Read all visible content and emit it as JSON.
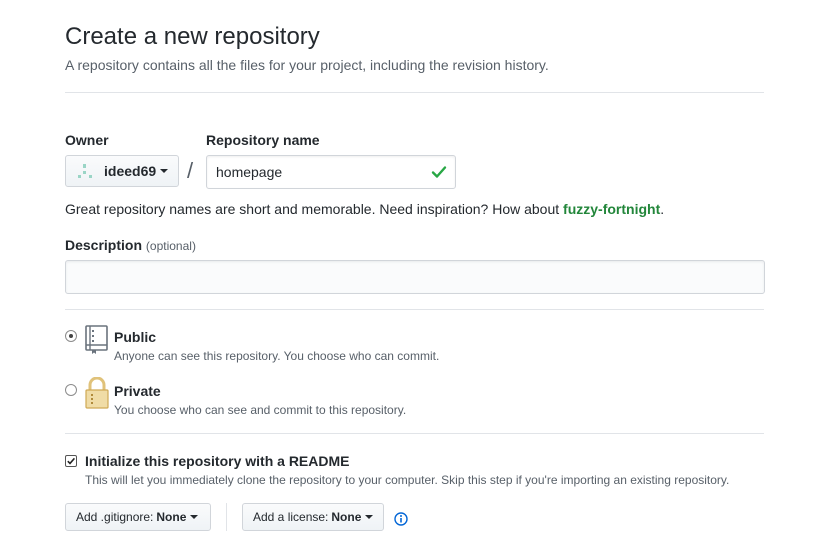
{
  "header": {
    "title": "Create a new repository",
    "subtitle": "A repository contains all the files for your project, including the revision history."
  },
  "owner": {
    "label": "Owner",
    "value": "ideed69"
  },
  "separator": "/",
  "repo_name": {
    "label": "Repository name",
    "value": "homepage"
  },
  "hint": {
    "text": "Great repository names are short and memorable. Need inspiration? How about ",
    "suggestion": "fuzzy-fortnight",
    "end": "."
  },
  "description": {
    "label": "Description",
    "optional": "(optional)",
    "value": ""
  },
  "visibility": {
    "public": {
      "title": "Public",
      "note": "Anyone can see this repository. You choose who can commit.",
      "selected": true
    },
    "private": {
      "title": "Private",
      "note": "You choose who can see and commit to this repository.",
      "selected": false
    }
  },
  "readme": {
    "label": "Initialize this repository with a README",
    "note": "This will let you immediately clone the repository to your computer. Skip this step if you're importing an existing repository.",
    "checked": true
  },
  "gitignore": {
    "prefix": "Add .gitignore:",
    "value": "None"
  },
  "license": {
    "prefix": "Add a license:",
    "value": "None"
  },
  "colors": {
    "accent_green": "#22863a",
    "info_blue": "#0366d6"
  },
  "icons": [
    "identicon-avatar",
    "check-icon",
    "repo-book-icon",
    "lock-icon",
    "info-icon",
    "caret-down-icon"
  ]
}
